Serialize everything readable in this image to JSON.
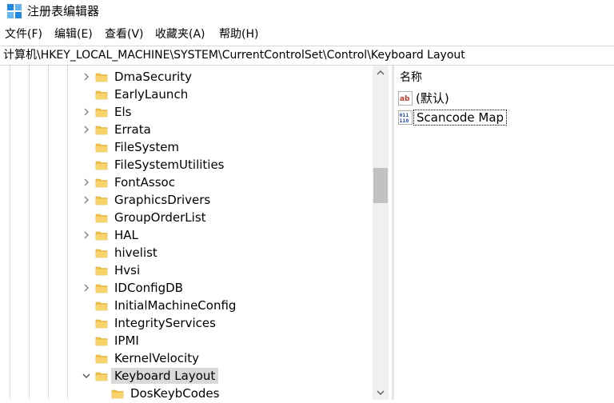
{
  "window": {
    "title": "注册表编辑器"
  },
  "menu": {
    "items": [
      {
        "label": "文件(F)"
      },
      {
        "label": "编辑(E)"
      },
      {
        "label": "查看(V)"
      },
      {
        "label": "收藏夹(A)"
      },
      {
        "label": "帮助(H)"
      }
    ]
  },
  "address": {
    "path": "计算机\\HKEY_LOCAL_MACHINE\\SYSTEM\\CurrentControlSet\\Control\\Keyboard Layout"
  },
  "tree": {
    "nodes": [
      {
        "label": "DmaSecurity",
        "expander": "collapsed",
        "selected": false
      },
      {
        "label": "EarlyLaunch",
        "expander": "none",
        "selected": false
      },
      {
        "label": "Els",
        "expander": "collapsed",
        "selected": false
      },
      {
        "label": "Errata",
        "expander": "collapsed",
        "selected": false
      },
      {
        "label": "FileSystem",
        "expander": "none",
        "selected": false
      },
      {
        "label": "FileSystemUtilities",
        "expander": "none",
        "selected": false
      },
      {
        "label": "FontAssoc",
        "expander": "collapsed",
        "selected": false
      },
      {
        "label": "GraphicsDrivers",
        "expander": "collapsed",
        "selected": false
      },
      {
        "label": "GroupOrderList",
        "expander": "none",
        "selected": false
      },
      {
        "label": "HAL",
        "expander": "collapsed",
        "selected": false
      },
      {
        "label": "hivelist",
        "expander": "none",
        "selected": false
      },
      {
        "label": "Hvsi",
        "expander": "none",
        "selected": false
      },
      {
        "label": "IDConfigDB",
        "expander": "collapsed",
        "selected": false
      },
      {
        "label": "InitialMachineConfig",
        "expander": "none",
        "selected": false
      },
      {
        "label": "IntegrityServices",
        "expander": "none",
        "selected": false
      },
      {
        "label": "IPMI",
        "expander": "none",
        "selected": false
      },
      {
        "label": "KernelVelocity",
        "expander": "none",
        "selected": false
      },
      {
        "label": "Keyboard Layout",
        "expander": "expanded",
        "selected": true
      },
      {
        "label": "DosKeybCodes",
        "expander": "none",
        "selected": false,
        "child": true
      }
    ]
  },
  "values": {
    "column_name": "名称",
    "items": [
      {
        "name": "(默认)",
        "icon": "string-value-icon"
      },
      {
        "name": "Scancode Map",
        "icon": "binary-value-icon"
      }
    ]
  },
  "colors": {
    "folder": "#f3c24b",
    "selection": "#d9d9d9",
    "scrollbar_thumb": "#c1c1c1"
  }
}
